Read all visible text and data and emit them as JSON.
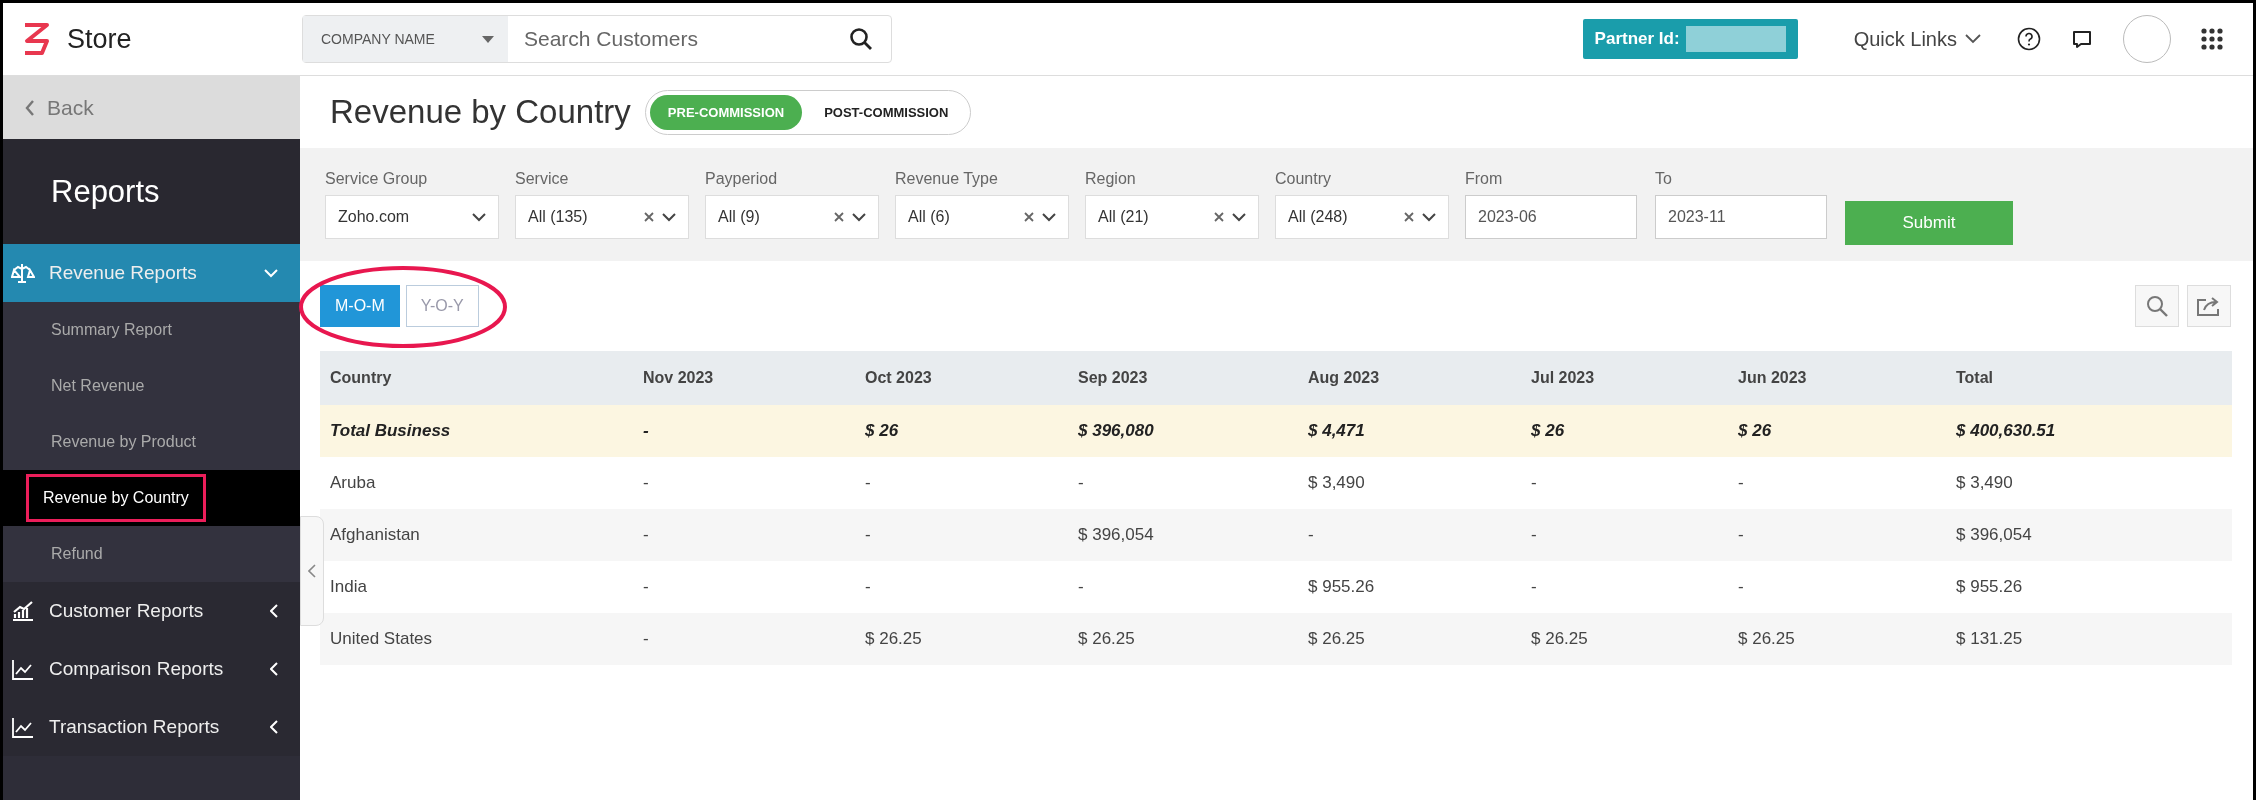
{
  "header": {
    "logo_text": "Store",
    "search": {
      "scope": "COMPANY NAME",
      "placeholder": "Search Customers"
    },
    "partner_label": "Partner Id:",
    "quick_links": "Quick Links"
  },
  "sidebar": {
    "back": "Back",
    "title": "Reports",
    "groups": [
      {
        "label": "Revenue Reports",
        "kind": "scale",
        "expanded": true,
        "children": [
          {
            "label": "Summary Report",
            "selected": false
          },
          {
            "label": "Net Revenue",
            "selected": false
          },
          {
            "label": "Revenue by Product",
            "selected": false
          },
          {
            "label": "Revenue by Country",
            "selected": true
          },
          {
            "label": "Refund",
            "selected": false
          }
        ]
      },
      {
        "label": "Customer Reports",
        "kind": "growth",
        "expanded": false
      },
      {
        "label": "Comparison Reports",
        "kind": "line",
        "expanded": false
      },
      {
        "label": "Transaction Reports",
        "kind": "line",
        "expanded": false
      }
    ]
  },
  "page": {
    "title": "Revenue by Country",
    "commission_tabs": [
      {
        "label": "PRE-COMMISSION",
        "selected": true
      },
      {
        "label": "POST-COMMISSION",
        "selected": false
      }
    ]
  },
  "filters": [
    {
      "kind": "select",
      "label": "Service Group",
      "value": "Zoho.com",
      "clearable": false
    },
    {
      "kind": "select",
      "label": "Service",
      "value": "All (135)",
      "clearable": true
    },
    {
      "kind": "select",
      "label": "Payperiod",
      "value": "All (9)",
      "clearable": true
    },
    {
      "kind": "select",
      "label": "Revenue Type",
      "value": "All (6)",
      "clearable": true
    },
    {
      "kind": "select",
      "label": "Region",
      "value": "All (21)",
      "clearable": true
    },
    {
      "kind": "select",
      "label": "Country",
      "value": "All (248)",
      "clearable": true
    },
    {
      "kind": "date",
      "label": "From",
      "value": "2023-06"
    },
    {
      "kind": "date",
      "label": "To",
      "value": "2023-11"
    }
  ],
  "submit": "Submit",
  "period_tabs": [
    {
      "label": "M-O-M",
      "selected": true
    },
    {
      "label": "Y-O-Y",
      "selected": false
    }
  ],
  "table": {
    "columns": [
      "Country",
      "Nov 2023",
      "Oct 2023",
      "Sep 2023",
      "Aug 2023",
      "Jul 2023",
      "Jun 2023",
      "Total"
    ],
    "rows": [
      {
        "kind": "total",
        "cells": [
          "Total Business",
          "-",
          "$ 26",
          "$ 396,080",
          "$ 4,471",
          "$ 26",
          "$ 26",
          "$ 400,630.51"
        ]
      },
      {
        "kind": "country",
        "cells": [
          "Aruba",
          "-",
          "-",
          "-",
          "$ 3,490",
          "-",
          "-",
          "$ 3,490"
        ]
      },
      {
        "kind": "country",
        "cells": [
          "Afghanistan",
          "-",
          "-",
          "$ 396,054",
          "-",
          "-",
          "-",
          "$ 396,054"
        ]
      },
      {
        "kind": "country",
        "cells": [
          "India",
          "-",
          "-",
          "-",
          "$ 955.26",
          "-",
          "-",
          "$ 955.26"
        ]
      },
      {
        "kind": "country",
        "cells": [
          "United States",
          "-",
          "$ 26.25",
          "$ 26.25",
          "$ 26.25",
          "$ 26.25",
          "$ 26.25",
          "$ 131.25"
        ]
      }
    ]
  }
}
